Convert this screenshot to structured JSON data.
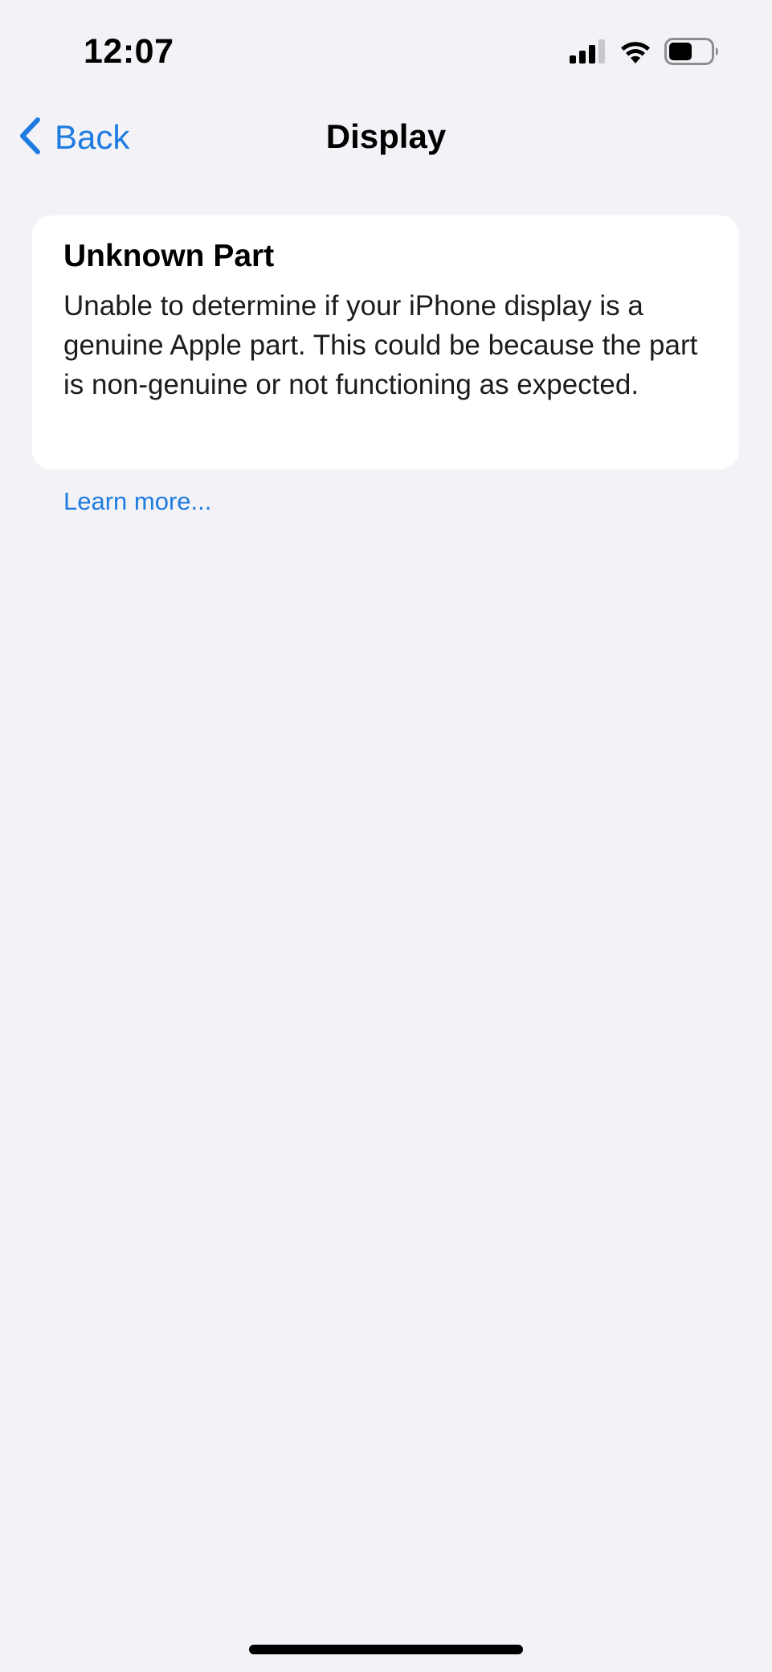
{
  "status_bar": {
    "time": "12:07",
    "icons": [
      "signal-icon",
      "wifi-icon",
      "battery-icon"
    ]
  },
  "nav": {
    "back_label": "Back",
    "back_icon": "chevron-left-icon",
    "title": "Display"
  },
  "card": {
    "title": "Unknown Part",
    "body": "Unable to determine if your iPhone display is a genuine Apple part. This could be because the part is non-genuine or not functioning as expected."
  },
  "learn_more": {
    "label": "Learn more..."
  },
  "colors": {
    "background": "#F2F2F7",
    "card": "#FFFFFF",
    "accent": "#1E7BE0",
    "text": "#000000"
  }
}
